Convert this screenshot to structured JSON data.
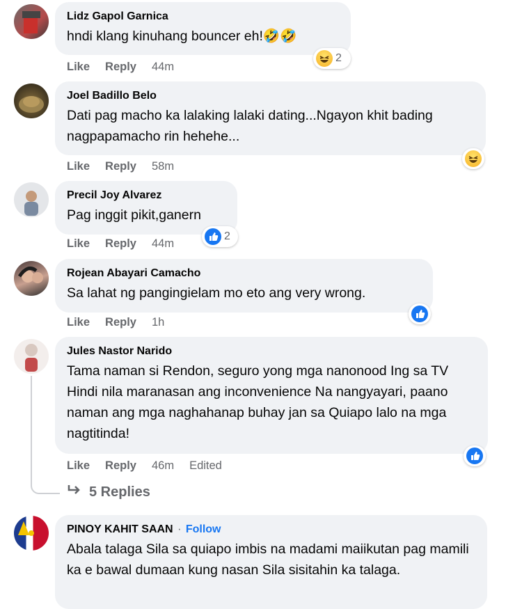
{
  "comments": [
    {
      "author": "Lidz Gapol Garnica",
      "text": "hndi klang kinuhang bouncer eh!🤣🤣",
      "like": "Like",
      "reply": "Reply",
      "time": "44m",
      "reaction": {
        "type": "haha",
        "count": "2"
      }
    },
    {
      "author": "Joel Badillo Belo",
      "text": "Dati pag macho ka lalaking lalaki dating...Ngayon khit bading nagpapamacho rin hehehe...",
      "like": "Like",
      "reply": "Reply",
      "time": "58m",
      "reaction": {
        "type": "haha",
        "count": ""
      }
    },
    {
      "author": "Precil Joy Alvarez",
      "text": "Pag inggit pikit,ganern",
      "like": "Like",
      "reply": "Reply",
      "time": "44m",
      "reaction": {
        "type": "like",
        "count": "2"
      }
    },
    {
      "author": "Rojean Abayari Camacho",
      "text": "Sa lahat ng pangingielam mo eto ang very wrong.",
      "like": "Like",
      "reply": "Reply",
      "time": "1h",
      "reaction": {
        "type": "like",
        "count": ""
      }
    },
    {
      "author": "Jules Nastor Narido",
      "text": "Tama naman si Rendon, seguro yong mga nanonood Ing sa TV Hindi nila maranasan ang inconvenience Na nangyayari, paano naman ang mga naghahanap buhay jan sa Quiapo lalo na mga nagtitinda!",
      "like": "Like",
      "reply": "Reply",
      "time": "46m",
      "edited": "Edited",
      "reaction": {
        "type": "like",
        "count": ""
      },
      "replies_label": "5 Replies"
    },
    {
      "author": "PINOY KAHIT SAAN",
      "separator": "·",
      "follow": "Follow",
      "text": "Abala talaga Sila sa quiapo imbis na madami maiikutan pag mamili ka e bawal dumaan kung nasan Sila sisitahin ka talaga."
    }
  ],
  "colors": {
    "bubble": "#f0f2f5",
    "meta": "#65676b",
    "link": "#1877f2",
    "like_blue": "#1877f2",
    "haha_yellow": "#f7b125"
  },
  "icons": {
    "haha": "haha-reaction-icon",
    "like": "like-reaction-icon",
    "reply_arrow": "reply-arrow-icon"
  }
}
